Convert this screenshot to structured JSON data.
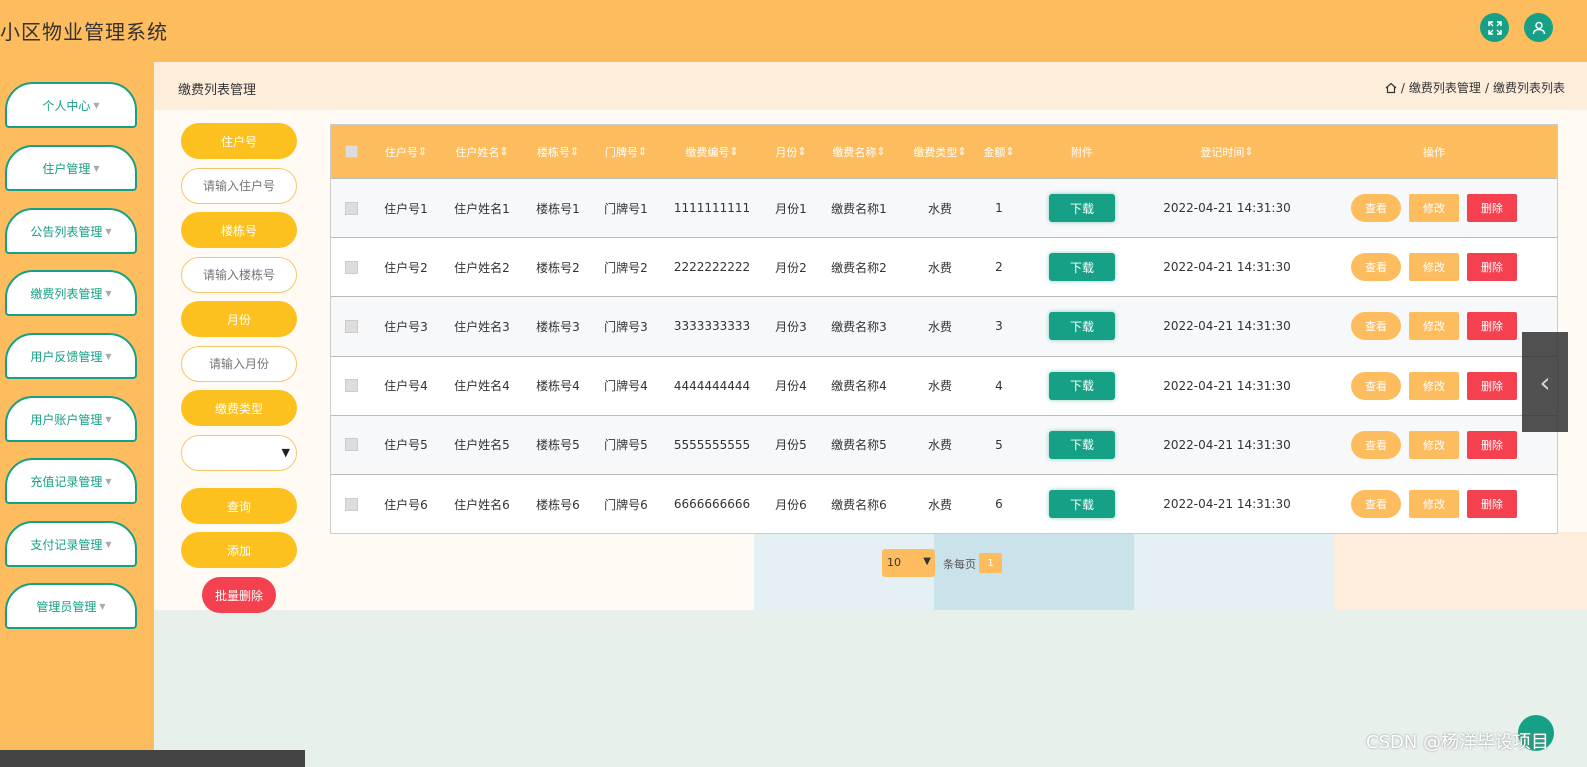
{
  "header": {
    "title": "小区物业管理系统",
    "fullscreen_icon": "expand-icon",
    "user_icon": "user-icon"
  },
  "sidebar": {
    "items": [
      {
        "label": "个人中心"
      },
      {
        "label": "住户管理"
      },
      {
        "label": "公告列表管理"
      },
      {
        "label": "缴费列表管理"
      },
      {
        "label": "用户反馈管理"
      },
      {
        "label": "用户账户管理"
      },
      {
        "label": "充值记录管理"
      },
      {
        "label": "支付记录管理"
      },
      {
        "label": "管理员管理"
      }
    ]
  },
  "page": {
    "heading": "缴费列表管理",
    "breadcrumb": [
      "缴费列表管理",
      "缴费列表列表"
    ]
  },
  "search": {
    "resident_no_label": "住户号",
    "resident_no_placeholder": "请输入住户号",
    "building_label": "楼栋号",
    "building_placeholder": "请输入楼栋号",
    "month_label": "月份",
    "month_placeholder": "请输入月份",
    "fee_type_label": "缴费类型",
    "fee_type_value": "",
    "query_button": "查询",
    "add_button": "添加",
    "batch_delete_button": "批量删除"
  },
  "table": {
    "headers": [
      "住户号",
      "住户姓名",
      "楼栋号",
      "门牌号",
      "缴费编号",
      "月份",
      "缴费名称",
      "缴费类型",
      "金额",
      "附件",
      "登记时间",
      "操作"
    ],
    "sort_mark": "⇕",
    "rows": [
      [
        "住户号1",
        "住户姓名1",
        "楼栋号1",
        "门牌号1",
        "1111111111",
        "月份1",
        "缴费名称1",
        "水费",
        "1",
        "下载",
        "2022-04-21 14:31:30"
      ],
      [
        "住户号2",
        "住户姓名2",
        "楼栋号2",
        "门牌号2",
        "2222222222",
        "月份2",
        "缴费名称2",
        "水费",
        "2",
        "下载",
        "2022-04-21 14:31:30"
      ],
      [
        "住户号3",
        "住户姓名3",
        "楼栋号3",
        "门牌号3",
        "3333333333",
        "月份3",
        "缴费名称3",
        "水费",
        "3",
        "下载",
        "2022-04-21 14:31:30"
      ],
      [
        "住户号4",
        "住户姓名4",
        "楼栋号4",
        "门牌号4",
        "4444444444",
        "月份4",
        "缴费名称4",
        "水费",
        "4",
        "下载",
        "2022-04-21 14:31:30"
      ],
      [
        "住户号5",
        "住户姓名5",
        "楼栋号5",
        "门牌号5",
        "5555555555",
        "月份5",
        "缴费名称5",
        "水费",
        "5",
        "下载",
        "2022-04-21 14:31:30"
      ],
      [
        "住户号6",
        "住户姓名6",
        "楼栋号6",
        "门牌号6",
        "6666666666",
        "月份6",
        "缴费名称6",
        "水费",
        "6",
        "下载",
        "2022-04-21 14:31:30"
      ]
    ],
    "actions": {
      "view": "查看",
      "edit": "修改",
      "delete": "删除"
    }
  },
  "pagination": {
    "page_size": "10",
    "per_page_text": "条每页",
    "current_page": "1"
  },
  "watermark": "CSDN @杨洋毕设项目",
  "colors": {
    "header_bg": "#fdbd5e",
    "accent_green": "#16a085",
    "accent_yellow": "#fcc11e",
    "danger": "#f5404f"
  }
}
